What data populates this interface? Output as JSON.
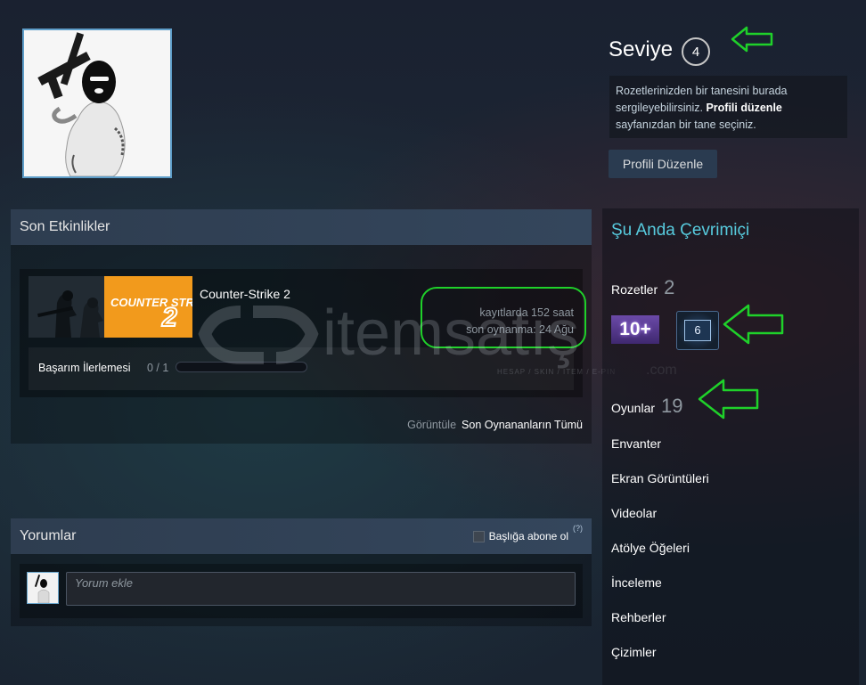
{
  "profile": {
    "level_label": "Seviye",
    "level_value": "4",
    "badge_tip": {
      "part1": "Rozetlerinizden bir tanesini burada sergileyebilirsiniz. ",
      "link": "Profili düzenle",
      "part2": " sayfanızdan bir tane seçiniz."
    },
    "edit_button": "Profili Düzenle"
  },
  "recent": {
    "title": "Son Etkinlikler",
    "game": {
      "name": "Counter-Strike 2",
      "capsule_text": "COUNTER STRIKE",
      "capsule_num": "2",
      "hours": "kayıtlarda 152 saat",
      "last_played": "son oynanma: 24 Ağu",
      "achievements_label": "Başarım İlerlemesi",
      "achievements_count": "0 / 1",
      "achievement_progress": 0
    },
    "view_prefix": "Görüntüle",
    "view_link": "Son Oynananların Tümü"
  },
  "comments": {
    "title": "Yorumlar",
    "subscribe_label": "Başlığa abone ol",
    "help": "(?)",
    "placeholder": "Yorum ekle"
  },
  "sidebar": {
    "status": "Şu Anda Çevrimiçi",
    "badges_label": "Rozetler",
    "badges_count": "2",
    "badge1_text": "10+",
    "badge2_text": "6",
    "games_label": "Oyunlar",
    "games_count": "19",
    "links": [
      "Envanter",
      "Ekran Görüntüleri",
      "Videolar",
      "Atölye Öğeleri",
      "İnceleme",
      "Rehberler",
      "Çizimler"
    ]
  },
  "watermark": {
    "brand": "itemsatış",
    "tld": ".com",
    "tagline": "HESAP / SKIN / ITEM / E-PIN"
  },
  "colors": {
    "accent": "#57cbde",
    "annotation": "#1fd12a",
    "capsule_orange": "#f39c1b"
  }
}
